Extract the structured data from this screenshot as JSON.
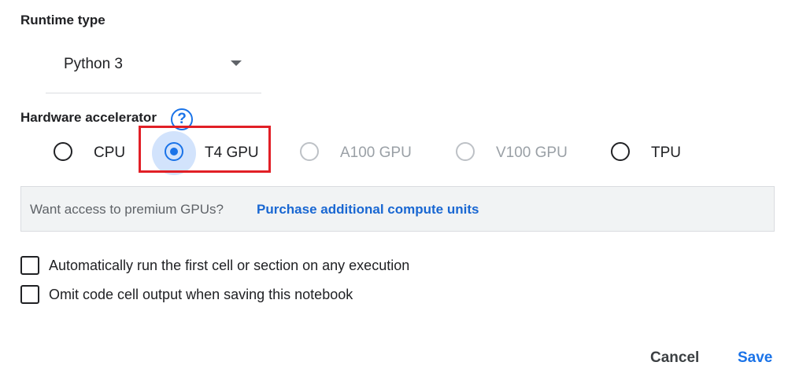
{
  "runtime": {
    "section_title": "Runtime type",
    "selected_value": "Python 3",
    "caret_icon": "caret-down-icon"
  },
  "hardware": {
    "section_title": "Hardware accelerator",
    "help_icon": "help-circle-icon",
    "help_glyph": "?",
    "options": [
      {
        "label": "CPU",
        "selected": false,
        "disabled": false
      },
      {
        "label": "T4 GPU",
        "selected": true,
        "disabled": false
      },
      {
        "label": "A100 GPU",
        "selected": false,
        "disabled": true
      },
      {
        "label": "V100 GPU",
        "selected": false,
        "disabled": true
      },
      {
        "label": "TPU",
        "selected": false,
        "disabled": false
      }
    ]
  },
  "banner": {
    "text": "Want access to premium GPUs?",
    "link": "Purchase additional compute units"
  },
  "checkboxes": [
    {
      "label": "Automatically run the first cell or section on any execution",
      "checked": false
    },
    {
      "label": "Omit code cell output when saving this notebook",
      "checked": false
    }
  ],
  "footer": {
    "cancel_label": "Cancel",
    "save_label": "Save"
  },
  "colors": {
    "accent": "#1a73e8",
    "highlight": "#e11f26",
    "banner_bg": "#f1f3f4",
    "disabled": "#9aa0a6"
  }
}
